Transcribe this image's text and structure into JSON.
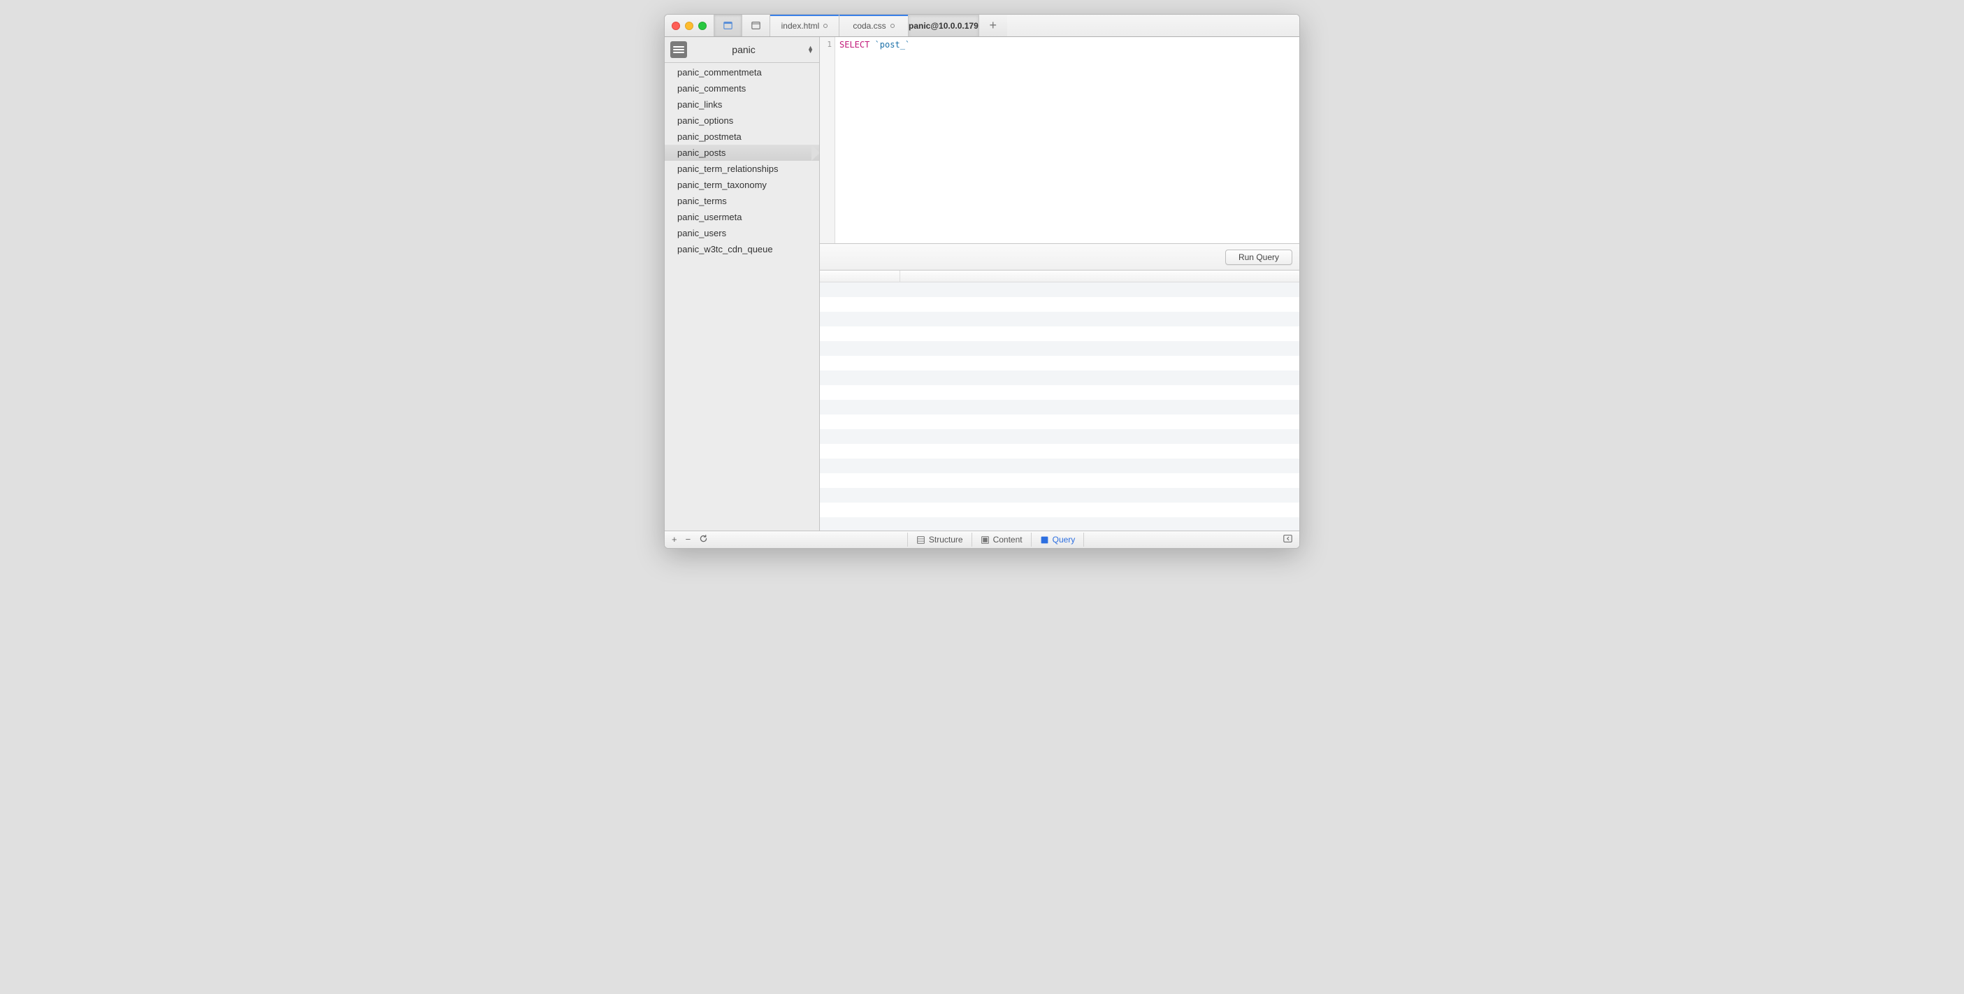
{
  "tabs": [
    {
      "label": "index.html",
      "dirty": true,
      "active": false
    },
    {
      "label": "coda.css",
      "dirty": true,
      "active": false
    },
    {
      "label": "panic@10.0.0.179",
      "dirty": false,
      "active": true
    }
  ],
  "database": {
    "name": "panic"
  },
  "tables": [
    "panic_commentmeta",
    "panic_comments",
    "panic_links",
    "panic_options",
    "panic_postmeta",
    "panic_posts",
    "panic_term_relationships",
    "panic_term_taxonomy",
    "panic_terms",
    "panic_usermeta",
    "panic_users",
    "panic_w3tc_cdn_queue"
  ],
  "selected_table_index": 5,
  "editor": {
    "line_number": "1",
    "keyword": "SELECT",
    "rest": " `post_`"
  },
  "run_button": "Run Query",
  "footer_tabs": {
    "structure": "Structure",
    "content": "Content",
    "query": "Query"
  }
}
